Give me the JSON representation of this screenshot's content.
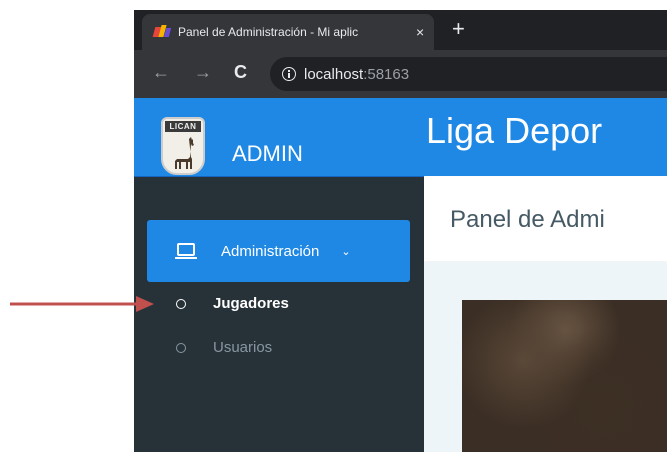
{
  "browser": {
    "tab_title": "Panel de Administración - Mi aplic",
    "close_glyph": "×",
    "newtab_glyph": "+",
    "back_glyph": "←",
    "forward_glyph": "→",
    "reload_glyph": "C",
    "url_host": "localhost",
    "url_port": ":58163"
  },
  "brand": {
    "logo_text": "LICAN",
    "title": "ADMIN"
  },
  "header": {
    "site_title": "Liga Depor"
  },
  "sidebar": {
    "menu_header": {
      "label": "Administración",
      "icon": "laptop-icon",
      "chevron": "⌄"
    },
    "items": [
      {
        "label": "Jugadores",
        "active": true
      },
      {
        "label": "Usuarios",
        "active": false
      }
    ]
  },
  "content": {
    "page_title": "Panel de Admi"
  },
  "colors": {
    "primary": "#1f88e5",
    "sidebar": "#263238",
    "annotation_arrow": "#c0504d"
  }
}
